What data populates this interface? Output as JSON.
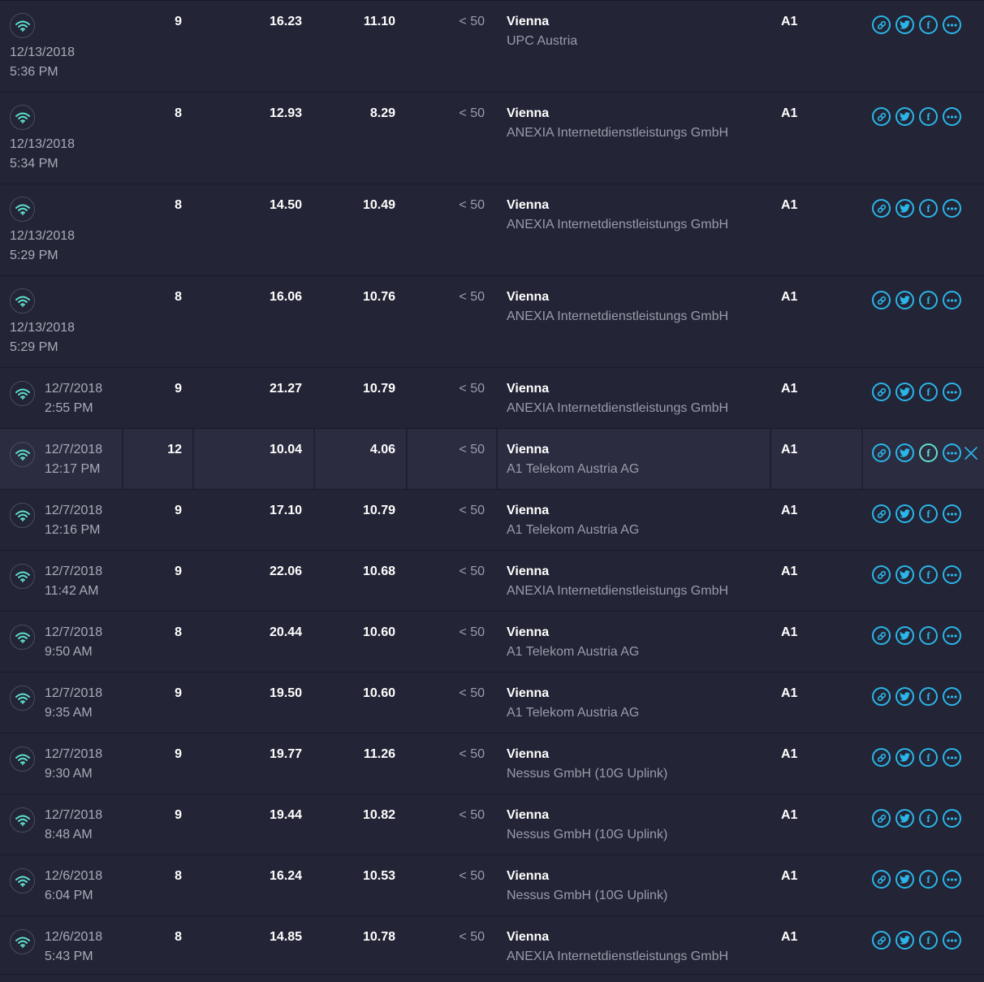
{
  "rows": [
    {
      "date": "12/13/2018",
      "time": "5:36 PM",
      "ping": "9",
      "download": "16.23",
      "upload": "11.10",
      "jitter": "< 50",
      "city": "Vienna",
      "isp": "UPC Austria",
      "server": "A1"
    },
    {
      "date": "12/13/2018",
      "time": "5:34 PM",
      "ping": "8",
      "download": "12.93",
      "upload": "8.29",
      "jitter": "< 50",
      "city": "Vienna",
      "isp": "ANEXIA Internetdienstleistungs GmbH",
      "server": "A1"
    },
    {
      "date": "12/13/2018",
      "time": "5:29 PM",
      "ping": "8",
      "download": "14.50",
      "upload": "10.49",
      "jitter": "< 50",
      "city": "Vienna",
      "isp": "ANEXIA Internetdienstleistungs GmbH",
      "server": "A1"
    },
    {
      "date": "12/13/2018",
      "time": "5:29 PM",
      "ping": "8",
      "download": "16.06",
      "upload": "10.76",
      "jitter": "< 50",
      "city": "Vienna",
      "isp": "ANEXIA Internetdienstleistungs GmbH",
      "server": "A1"
    },
    {
      "date": "12/7/2018",
      "time": "2:55 PM",
      "ping": "9",
      "download": "21.27",
      "upload": "10.79",
      "jitter": "< 50",
      "city": "Vienna",
      "isp": "ANEXIA Internetdienstleistungs GmbH",
      "server": "A1"
    },
    {
      "date": "12/7/2018",
      "time": "12:17 PM",
      "ping": "12",
      "download": "10.04",
      "upload": "4.06",
      "jitter": "< 50",
      "city": "Vienna",
      "isp": "A1 Telekom Austria AG",
      "server": "A1"
    },
    {
      "date": "12/7/2018",
      "time": "12:16 PM",
      "ping": "9",
      "download": "17.10",
      "upload": "10.79",
      "jitter": "< 50",
      "city": "Vienna",
      "isp": "A1 Telekom Austria AG",
      "server": "A1"
    },
    {
      "date": "12/7/2018",
      "time": "11:42 AM",
      "ping": "9",
      "download": "22.06",
      "upload": "10.68",
      "jitter": "< 50",
      "city": "Vienna",
      "isp": "ANEXIA Internetdienstleistungs GmbH",
      "server": "A1"
    },
    {
      "date": "12/7/2018",
      "time": "9:50 AM",
      "ping": "8",
      "download": "20.44",
      "upload": "10.60",
      "jitter": "< 50",
      "city": "Vienna",
      "isp": "A1 Telekom Austria AG",
      "server": "A1"
    },
    {
      "date": "12/7/2018",
      "time": "9:35 AM",
      "ping": "9",
      "download": "19.50",
      "upload": "10.60",
      "jitter": "< 50",
      "city": "Vienna",
      "isp": "A1 Telekom Austria AG",
      "server": "A1"
    },
    {
      "date": "12/7/2018",
      "time": "9:30 AM",
      "ping": "9",
      "download": "19.77",
      "upload": "11.26",
      "jitter": "< 50",
      "city": "Vienna",
      "isp": "Nessus GmbH (10G Uplink)",
      "server": "A1"
    },
    {
      "date": "12/7/2018",
      "time": "8:48 AM",
      "ping": "9",
      "download": "19.44",
      "upload": "10.82",
      "jitter": "< 50",
      "city": "Vienna",
      "isp": "Nessus GmbH (10G Uplink)",
      "server": "A1"
    },
    {
      "date": "12/6/2018",
      "time": "6:04 PM",
      "ping": "8",
      "download": "16.24",
      "upload": "10.53",
      "jitter": "< 50",
      "city": "Vienna",
      "isp": "Nessus GmbH (10G Uplink)",
      "server": "A1"
    },
    {
      "date": "12/6/2018",
      "time": "5:43 PM",
      "ping": "8",
      "download": "14.85",
      "upload": "10.78",
      "jitter": "< 50",
      "city": "Vienna",
      "isp": "ANEXIA Internetdienstleistungs GmbH",
      "server": "A1"
    }
  ],
  "active_row": 5,
  "icons": {
    "connection": "wifi-icon",
    "actions": [
      "link-icon",
      "twitter-icon",
      "facebook-icon",
      "more-icon"
    ],
    "delete": "close-icon"
  },
  "colors": {
    "background": "#232435",
    "active_row": "#2b2c40",
    "accent": "#2ab6e9",
    "wifi": "#5fe0d0"
  }
}
